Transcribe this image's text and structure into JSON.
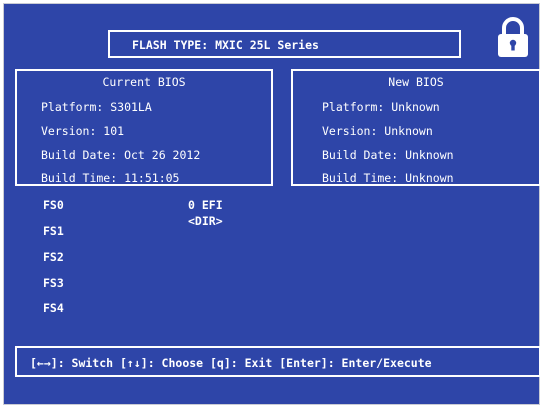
{
  "flash_type": "FLASH TYPE: MXIC 25L Series",
  "current_bios": {
    "title": "Current BIOS",
    "platform": "Platform: S301LA",
    "version": "Version: 101",
    "build_date": "Build Date: Oct 26 2012",
    "build_time": "Build Time: 11:51:05"
  },
  "new_bios": {
    "title": "New BIOS",
    "platform": "Platform: Unknown",
    "version": "Version: Unknown",
    "build_date": "Build Date: Unknown",
    "build_time": "Build Time: Unknown"
  },
  "filesystems": [
    "FS0",
    "FS1",
    "FS2",
    "FS3",
    "FS4"
  ],
  "directory": [
    "0 EFI",
    "<DIR>"
  ],
  "footer": "[←→]: Switch [↑↓]: Choose [q]: Exit [Enter]: Enter/Execute",
  "icons": {
    "lock": "lock-icon"
  },
  "colors": {
    "background": "#2e45a8",
    "foreground": "#ffffff"
  }
}
